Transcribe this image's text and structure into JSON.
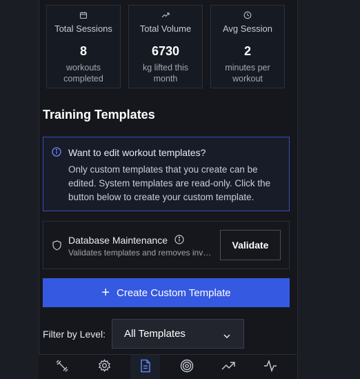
{
  "stats": [
    {
      "label": "Total Sessions",
      "value": "8",
      "sub": "workouts completed",
      "icon": "calendar-icon"
    },
    {
      "label": "Total Volume",
      "value": "6730",
      "sub": "kg lifted this month",
      "icon": "trend-up-icon"
    },
    {
      "label": "Avg Session",
      "value": "2",
      "sub": "minutes per workout",
      "icon": "clock-icon"
    }
  ],
  "section_title": "Training Templates",
  "info": {
    "title": "Want to edit workout templates?",
    "body": "Only custom templates that you create can be edited. System templates are read-only. Click the button below to create your custom template."
  },
  "maintenance": {
    "title": "Database Maintenance",
    "desc": "Validates templates and removes invalid entries",
    "button": "Validate"
  },
  "create_button": "Create Custom Template",
  "filter": {
    "label": "Filter by Level:",
    "selected": "All Templates"
  },
  "nav": [
    {
      "icon": "dumbbell-icon",
      "active": false
    },
    {
      "icon": "gear-icon",
      "active": false
    },
    {
      "icon": "document-icon",
      "active": true
    },
    {
      "icon": "target-icon",
      "active": false
    },
    {
      "icon": "trending-up-icon",
      "active": false
    },
    {
      "icon": "activity-icon",
      "active": false
    }
  ],
  "colors": {
    "accent": "#3559e0",
    "info_border": "#3a4fb8",
    "active_icon": "#5b86f0"
  }
}
